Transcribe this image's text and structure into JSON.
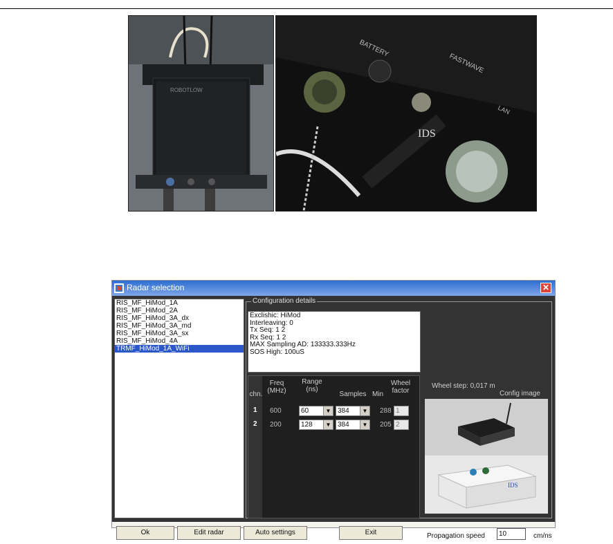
{
  "window": {
    "title": "Radar selection",
    "close_symbol": "✕"
  },
  "radar_list": [
    "RIS_MF_HiMod_1A",
    "RIS_MF_HiMod_2A",
    "RIS_MF_HiMod_3A_dx",
    "RIS_MF_HiMod_3A_md",
    "RIS_MF_HiMod_3A_sx",
    "RIS_MF_HiMod_4A",
    "TRMF_HiMod_1A_WiFi"
  ],
  "config": {
    "group_label": "Configuration details",
    "details_lines": [
      "Exclishic: HiMod",
      "Interleaving: 0",
      "Tx Seq: 1 2",
      "Rx Seq: 1 2",
      "MAX Sampling AD: 133333.333Hz",
      "SOS High: 100uS"
    ],
    "table": {
      "headers": {
        "ch": "chn.",
        "freq": "Freq\n(MHz)",
        "range": "Range\n(ns)",
        "samples": "Samples",
        "min": "Min",
        "wheel": "Wheel\nfactor"
      },
      "rows": [
        {
          "ch": "1",
          "freq": "600",
          "range": "60",
          "samples": "384",
          "min": "288",
          "wheel": "1"
        },
        {
          "ch": "2",
          "freq": "200",
          "range": "128",
          "samples": "384",
          "min": "205",
          "wheel": "2"
        }
      ]
    },
    "wheel_step": "Wheel step: 0,017 m",
    "config_image_label": "Config image"
  },
  "buttons": {
    "ok": "Ok",
    "edit": "Edit radar",
    "auto": "Auto settings",
    "exit": "Exit"
  },
  "speed": {
    "label": "Propagation speed",
    "value": "10",
    "unit": "cm/ns"
  },
  "icons": [
    "app-icon",
    "close-icon",
    "dropdown-arrow-icon"
  ]
}
